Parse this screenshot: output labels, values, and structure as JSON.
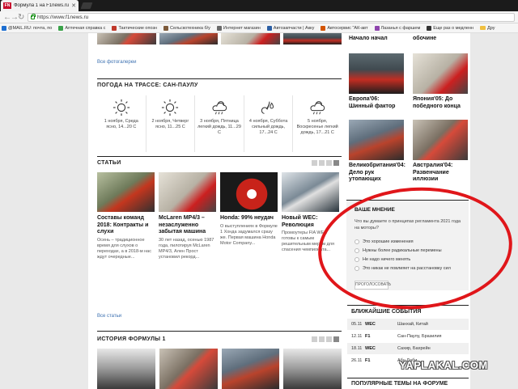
{
  "browser": {
    "tab_title": "Формула 1 на F1news.ru",
    "url": "https://www.f1news.ru",
    "bookmarks": [
      {
        "label": "@MAIL.RU: почта, по",
        "color": "#1d6fd1"
      },
      {
        "label": "Аптечная справка с",
        "color": "#3aa34a"
      },
      {
        "label": "Тактические опозн",
        "color": "#c0392b"
      },
      {
        "label": "Сельскотехника б/у",
        "color": "#7d5a3a"
      },
      {
        "label": "Интернет магазин",
        "color": "#6a6a6a"
      },
      {
        "label": "Автозапчасти | Акку",
        "color": "#2b5fa5"
      },
      {
        "label": "Автосервис \"АК-авт",
        "color": "#d35400"
      },
      {
        "label": "Лазанья с фаршем",
        "color": "#8e44ad"
      },
      {
        "label": "Еще раз о медленн",
        "color": "#333333"
      }
    ],
    "bookmarks_folder": "Дру"
  },
  "main": {
    "all_photos_link": "Все фотогалереи",
    "weather": {
      "title": "ПОГОДА НА ТРАССЕ: САН-ПАУЛУ",
      "days": [
        {
          "text": "1 ноября, Среда ясно, 14...20 С",
          "icon": "sun-icon"
        },
        {
          "text": "2 ноября, Четверг ясно, 11...25 С",
          "icon": "sun-icon"
        },
        {
          "text": "3 ноября, Пятница легкий дождь, 11...29 С",
          "icon": "rain-cloud-icon"
        },
        {
          "text": "4 ноября, Суббота сильный дождь, 17...24 С",
          "icon": "heavy-rain-icon"
        },
        {
          "text": "5 ноября, Воскресенье легкий дождь, 17...21 С",
          "icon": "rain-cloud-icon"
        }
      ]
    },
    "articles": {
      "title": "СТАТЬИ",
      "all_link": "Все статьи",
      "items": [
        {
          "title": "Составы команд 2018: Контракты и слухи",
          "desc": "Осень – традиционное время для слухов о переходах, а в 2018-м нас ждут очередные..."
        },
        {
          "title": "McLaren MP4/3 – незаслуженно забытая машина",
          "desc": "30 лет назад, осенью 1987 года, пилотируя McLaren MP4/3, Ален Прост установил рекорд..."
        },
        {
          "title": "Honda: 99% неудач",
          "desc": "О выступлениях в Формуле 1 Хонда задумался сразу же. Первая машина Honda Motor Company..."
        },
        {
          "title": "Новый WEC: Революция",
          "desc": "Промоутеры FIA WEC готовы к самым решительным мерам для спасения чемпионата..."
        }
      ]
    },
    "history": {
      "title": "ИСТОРИЯ ФОРМУЛЫ 1"
    }
  },
  "sidebar": {
    "gallery": [
      {
        "title": "Начало начал"
      },
      {
        "title": "обочине"
      },
      {
        "title": "Европа'06: Шинный фактор"
      },
      {
        "title": "Япония'05: До победного конца"
      },
      {
        "title": "Великобритания'04: Дело рук утопающих"
      },
      {
        "title": "Австралия'04: Развенчание иллюзии"
      }
    ],
    "poll": {
      "title": "ВАШЕ МНЕНИЕ",
      "question": "Что вы думаете о принципах регламента 2021 года на моторы?",
      "options": [
        "Это хорошие изменения",
        "Нужны более радикальные перемены",
        "Не надо ничего менять",
        "Это никак не повлияет на расстановку сил"
      ],
      "vote_label": "ПРОГОЛОСОВАТЬ"
    },
    "events": {
      "title": "БЛИЖАЙШИЕ СОБЫТИЯ",
      "rows": [
        {
          "date": "05.11",
          "series": "WEC",
          "place": "Шанхай, Китай"
        },
        {
          "date": "12.11",
          "series": "F1",
          "place": "Сан-Паулу, Бразилия"
        },
        {
          "date": "18.11",
          "series": "WEC",
          "place": "Сахир, Бахрейн"
        },
        {
          "date": "26.11",
          "series": "F1",
          "place": "Абу-Даби"
        }
      ]
    },
    "topics_title": "ПОПУЛЯРНЫЕ ТЕМЫ НА ФОРУМЕ"
  },
  "watermark": "YAPLAKAL.COM",
  "colors": {
    "annotation": "#e0161a",
    "link": "#3a6fb0",
    "brand": "#c8102e"
  }
}
